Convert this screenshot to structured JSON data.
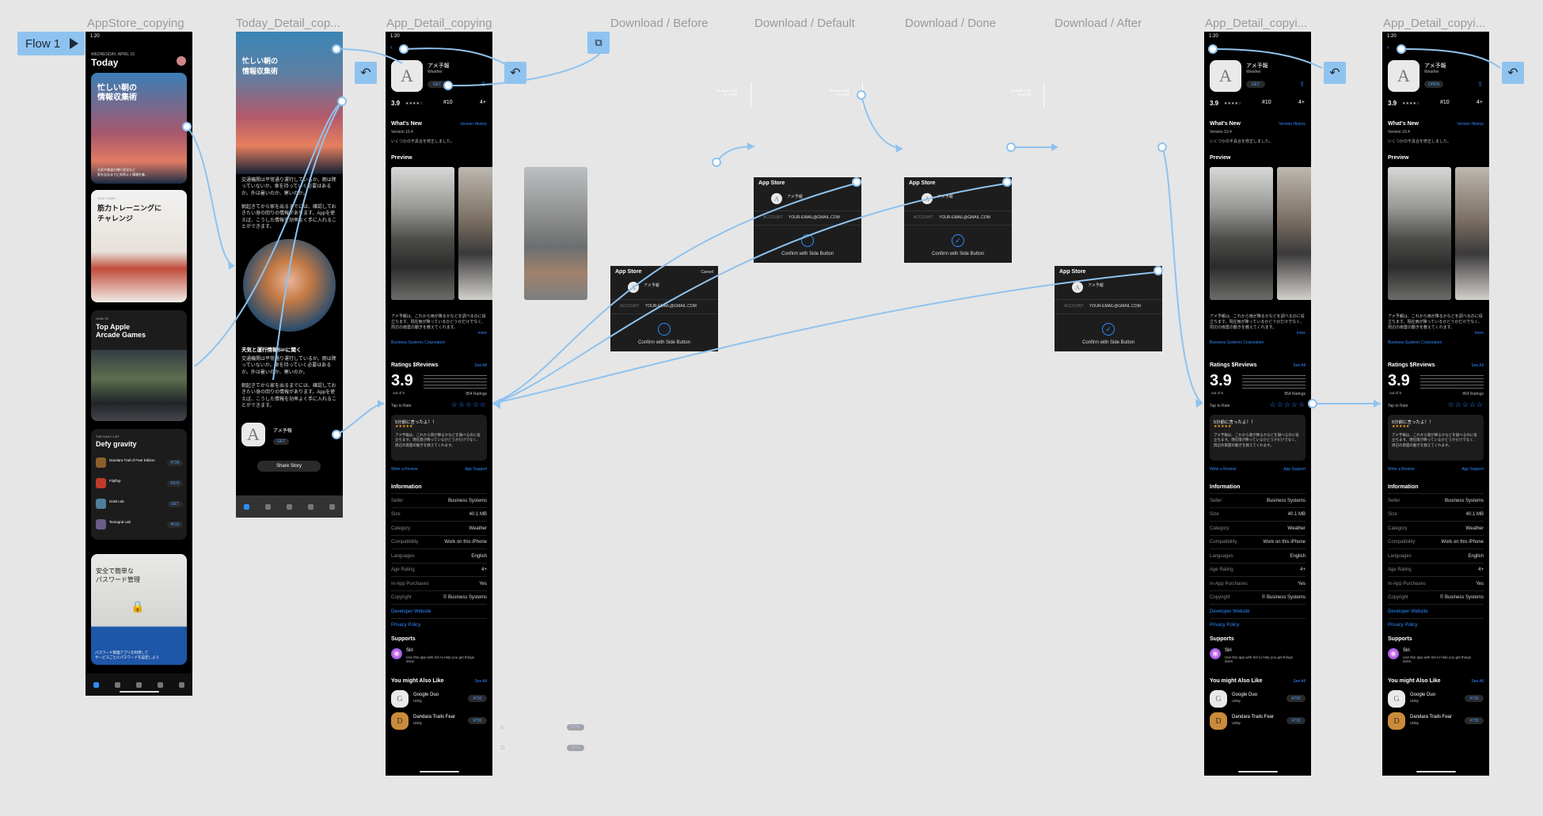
{
  "flow": {
    "label": "Flow 1"
  },
  "frames": {
    "appstore": "AppStore_copying",
    "today": "Today_Detail_cop...",
    "appdetail": "App_Detail_copying",
    "dl_before": "Download / Before",
    "dl_default": "Download / Default",
    "dl_done": "Download / Done",
    "dl_after": "Download / After",
    "appdetail2": "App_Detail_copyi...",
    "appdetail3": "App_Detail_copyi..."
  },
  "status_time": "1:20",
  "today_screen": {
    "date": "WEDNESDAY, APRIL 15",
    "title": "Today",
    "card1": "忙しい朝の\n情報収集術",
    "card1_sub": "天気や鉄道の運行状況など\n家を出るまでに効率よく情報を集...",
    "card2_tag": "STAY HOME",
    "card2": "筋力トレーニングに\nチャレンジ",
    "card3_tag": "HOW TO",
    "card3": "Top Apple\nArcade Games",
    "list_tag": "THE DAILY LIST",
    "list_title": "Defy gravity",
    "list_items": [
      {
        "name": "Dandara Trail of Fear Edition",
        "btn": "¥730"
      },
      {
        "name": "Flipflop",
        "btn": "¥370"
      },
      {
        "name": "Grab Lab",
        "btn": "GET"
      },
      {
        "name": "Tectogral Lab",
        "btn": "¥610"
      }
    ],
    "card5": "安全で簡単な\nパスワード管理",
    "card5_sub": "パスワード管理アプリを利用して\nサービスごとにパスワードを設定しよう"
  },
  "today_detail": {
    "title": "忙しい朝の\n情報収集術",
    "para1": "交通機関は平常通り運行しているか。雨は降っていないか。傘を持っていく必要はあるか。外は暑いのか、寒いのか。",
    "para2": "朝起きてから家を出るまでには、確認しておきたい身の回りの情報があります。Appを使えば、こうした情報を効率よく手に入れることができます。",
    "heading": "天気と運行情報Siriに聞く",
    "app_name": "アメ予報",
    "get": "GET",
    "share": "Share Story"
  },
  "app": {
    "name": "アメ予報",
    "category": "Weather",
    "button_before": "GET",
    "button_open": "OPEN",
    "rating": "3.9",
    "age": "4+",
    "rank": "#10",
    "whats_new": "What's New",
    "version_history": "Version History",
    "version": "Version 10.4",
    "version_note": "いくつかの不具合を修正しました。",
    "preview": "Preview",
    "desc": "アメ予報は、これから雨が降るかなどを調べるのに役立ちます。現在雨が降っているかどうかだけでなく、周辺の雨雲の動きを教えてくれます。",
    "more": "more",
    "developer": "Business Systems Corporation",
    "ratings_title": "Ratings $Reviews",
    "see_all": "See All",
    "out_of": "out of 5",
    "num_ratings": "854 Ratings",
    "tap_to_rate": "Tap to Rate",
    "review_title": "5分前に言ったよ！！",
    "review_body": "アメ予報は、これから雨が降るかなどを調べるのに役立ちます。現在雨が降っているかどうかだけでなく、周辺の雨雲の動きを教えてくれます。",
    "write_review": "Write a Review",
    "app_support": "App Support",
    "information": "Information",
    "info": [
      {
        "k": "Seller",
        "v": "Business Systems"
      },
      {
        "k": "Size",
        "v": "40.1 MB"
      },
      {
        "k": "Category",
        "v": "Weather"
      },
      {
        "k": "Compatibility",
        "v": "Work on this iPhone"
      },
      {
        "k": "Languages",
        "v": "English"
      },
      {
        "k": "Age Rating",
        "v": "4+"
      },
      {
        "k": "In-App Purchases",
        "v": "Yes"
      },
      {
        "k": "Copyright",
        "v": "© Business Systems"
      },
      {
        "k": "Developer Website",
        "v": ""
      },
      {
        "k": "Privacy Policy",
        "v": ""
      }
    ],
    "supports": "Supports",
    "siri": "Siri",
    "siri_desc": "Use this app with Siri to help you get things done.",
    "also_like": "You might Also Like",
    "similar": [
      {
        "name": "Google Duo",
        "cat": "Utility",
        "btn": "¥730"
      },
      {
        "name": "Dandara Trails Fear",
        "cat": "Utility",
        "btn": "¥730"
      }
    ]
  },
  "download": {
    "sheet_title": "App Store",
    "cancel": "Cancel",
    "account_label": "ACCOUNT",
    "account": "YOUR-EMAIL@GMAIL.COM",
    "confirm": "Confirm with Side Button",
    "double_click": "Double Click\nto Install"
  }
}
